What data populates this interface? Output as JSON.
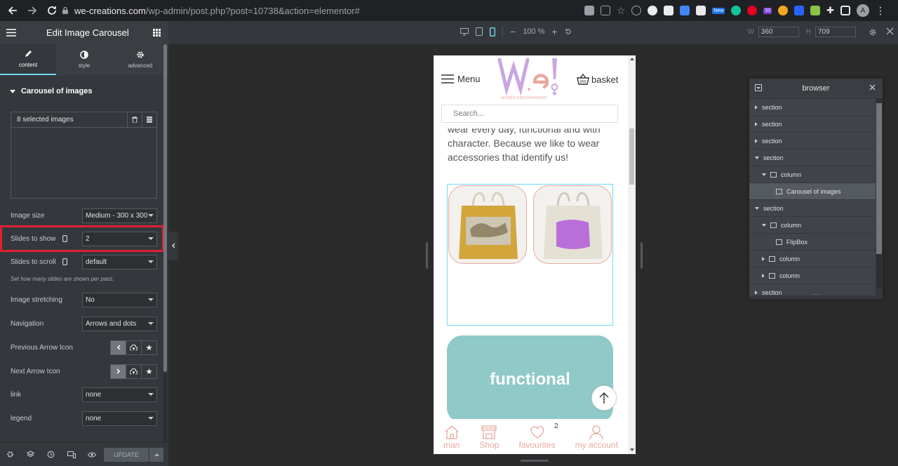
{
  "browser_chrome": {
    "url_host": "we-creations.com",
    "url_path": "/wp-admin/post.php?post=10738&action=elementor#",
    "ext_badge_new": "New",
    "ext_badge_count": "33",
    "profile_initial": "A"
  },
  "editor": {
    "panel_title": "Edit Image Carousel",
    "zoom_label": "100 %",
    "width_label": "W",
    "width_value": "360",
    "height_label": "H",
    "height_value": "709"
  },
  "sidebar": {
    "tabs": [
      {
        "label": "content",
        "icon": "pencil-icon"
      },
      {
        "label": "style",
        "icon": "half-circle-icon"
      },
      {
        "label": "advanced",
        "icon": "gear-icon"
      }
    ],
    "section_title": "Carousel of images",
    "gallery_label": "8 selected images",
    "controls": {
      "image_size": {
        "label": "Image size",
        "value": "Medium - 300 x 300"
      },
      "slides_to_show": {
        "label": "Slides to show",
        "value": "2"
      },
      "slides_to_scroll": {
        "label": "Slides to scroll",
        "value": "default"
      },
      "help_text": "Set how many slides are shown per pass.",
      "image_stretching": {
        "label": "Image stretching",
        "value": "No"
      },
      "navigation": {
        "label": "Navigation",
        "value": "Arrows and dots"
      },
      "prev_arrow": {
        "label": "Previous Arrow Icon"
      },
      "next_arrow": {
        "label": "Next Arrow Icon"
      },
      "link": {
        "label": "link",
        "value": "none"
      },
      "legend": {
        "label": "legend",
        "value": "none"
      }
    },
    "update_label": "UPDATE"
  },
  "preview": {
    "menu_label": "Menu",
    "logo_text": "We!",
    "logo_tagline": "WOMEN EMPOWERMENT",
    "basket_label": "basket",
    "search_placeholder": "Search...",
    "body_text": "wear every day, functional and with character. Because we like to wear accessories that identify us!",
    "card_title": "functional",
    "bottom_nav": [
      {
        "label": "man",
        "icon": "home-icon"
      },
      {
        "label": "Shop",
        "icon": "shop-icon"
      },
      {
        "label": "favourites",
        "icon": "heart-icon",
        "badge": "2"
      },
      {
        "label": "my account",
        "icon": "user-icon"
      }
    ]
  },
  "navigator": {
    "title": "browser",
    "items": [
      {
        "label": "section",
        "level": 0,
        "expanded": false
      },
      {
        "label": "section",
        "level": 0,
        "expanded": false
      },
      {
        "label": "section",
        "level": 0,
        "expanded": false
      },
      {
        "label": "section",
        "level": 0,
        "expanded": true
      },
      {
        "label": "column",
        "level": 1,
        "expanded": true
      },
      {
        "label": "Carousel of images",
        "level": 2,
        "active": true
      },
      {
        "label": "section",
        "level": 0,
        "expanded": true
      },
      {
        "label": "column",
        "level": 1,
        "expanded": true
      },
      {
        "label": "FlipBox",
        "level": 2
      },
      {
        "label": "column",
        "level": 1,
        "expanded": false
      },
      {
        "label": "column",
        "level": 1,
        "expanded": false
      },
      {
        "label": "section",
        "level": 0,
        "expanded": false
      }
    ]
  },
  "colors": {
    "accent": "#71d7f7",
    "highlight": "#e0202f",
    "brand_pink": "#e8a89e",
    "card_teal": "#8fc9c8"
  }
}
